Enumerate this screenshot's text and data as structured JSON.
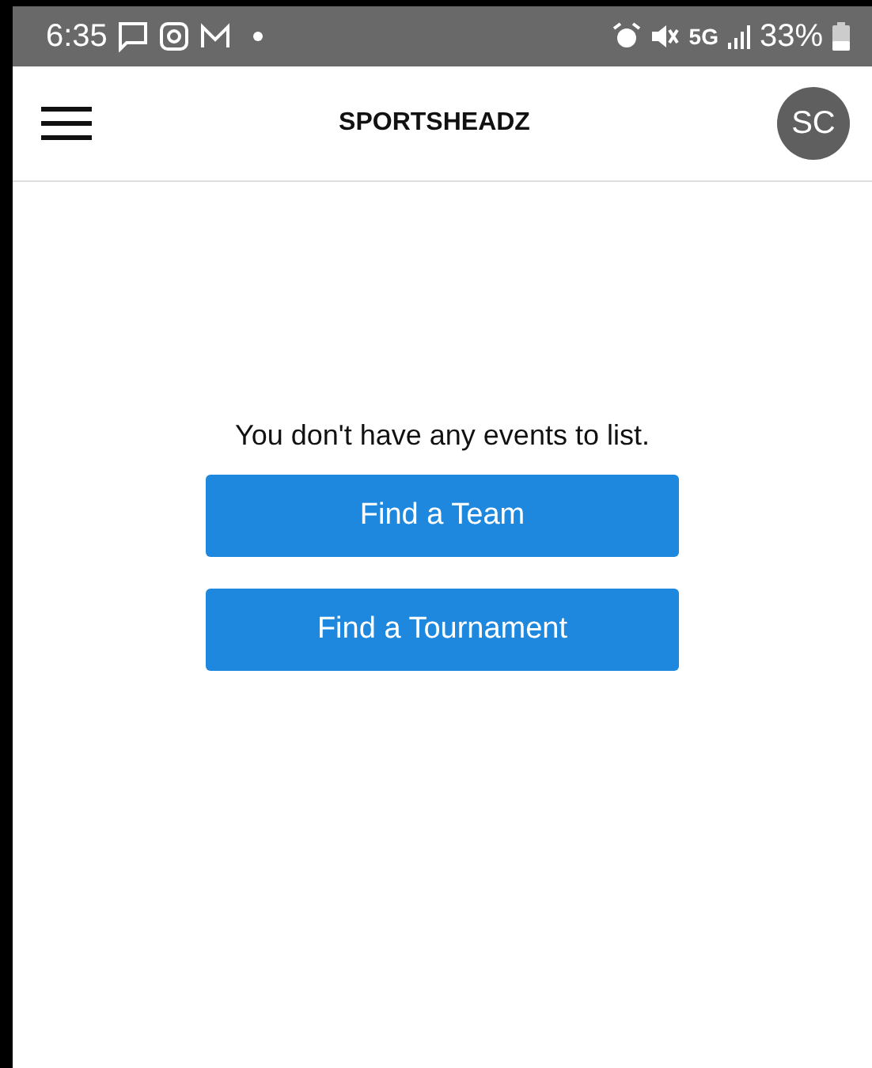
{
  "status_bar": {
    "time": "6:35",
    "network": "5G",
    "battery": "33%"
  },
  "header": {
    "title": "SPORTSHEADZ",
    "avatar": "SC"
  },
  "empty_message": "You don't have any events to list.",
  "buttons": [
    "Find a Team",
    "Find a Tournament"
  ]
}
